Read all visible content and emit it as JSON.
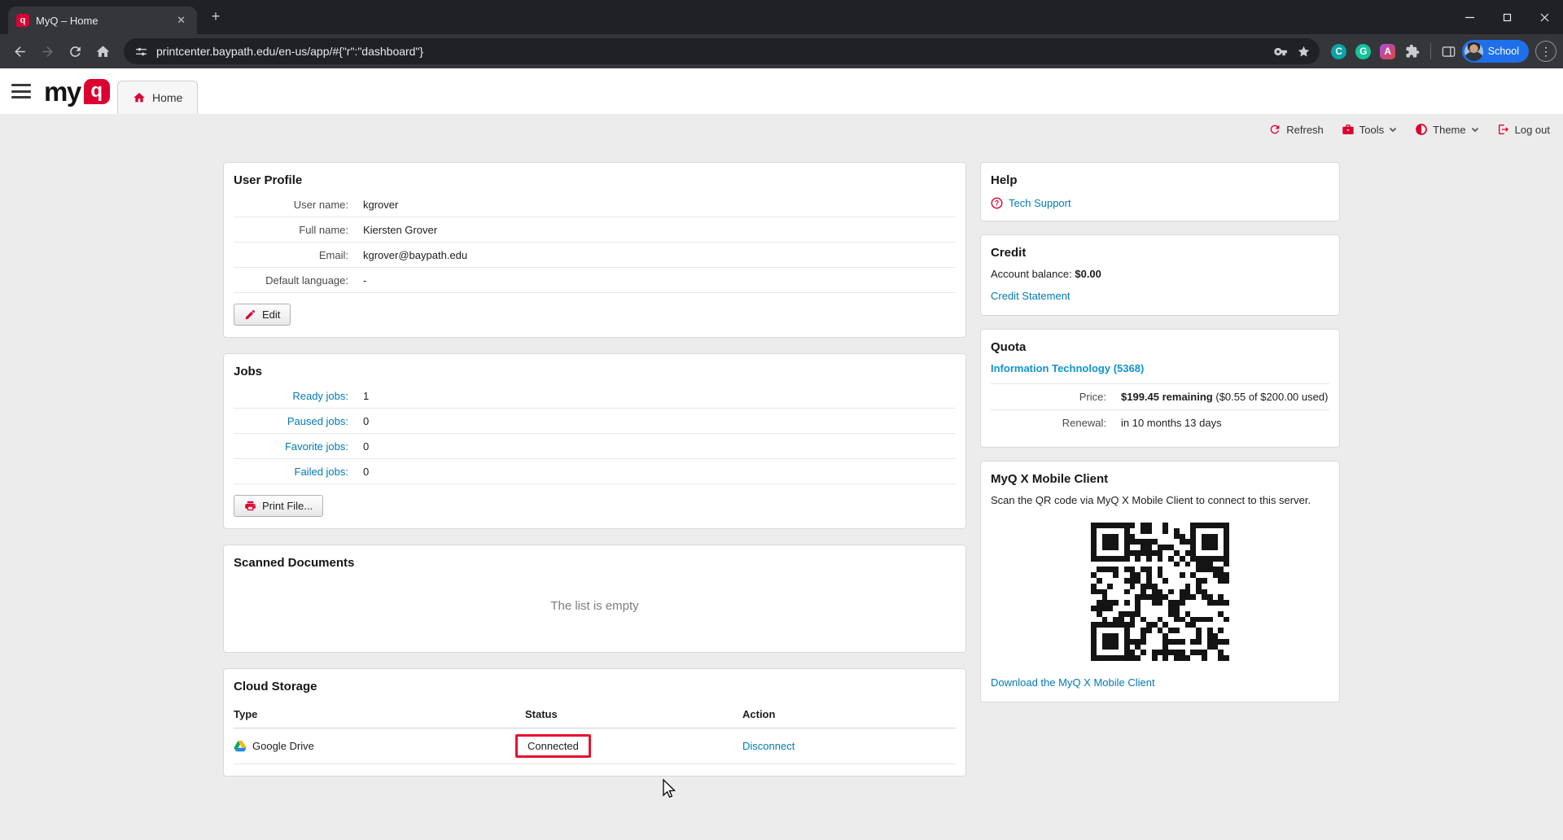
{
  "colors": {
    "brand_red": "#dc0032",
    "link_blue": "#0079b8",
    "quota_link_blue": "#0f93d0",
    "highlight_red": "#e8112d",
    "profile_chip_blue": "#1f6feb"
  },
  "browser": {
    "tab_title": "MyQ – Home",
    "url": "printcenter.baypath.edu/en-us/app/#{\"r\":\"dashboard\"}",
    "profile_label": "School"
  },
  "header": {
    "logo_prefix": "my",
    "logo_q": "q",
    "home_tab_label": "Home"
  },
  "action_bar": {
    "refresh_label": "Refresh",
    "tools_label": "Tools",
    "theme_label": "Theme",
    "logout_label": "Log out"
  },
  "cards": {
    "user_profile": {
      "title": "User Profile",
      "fields": [
        {
          "label": "User name:",
          "value": "kgrover"
        },
        {
          "label": "Full name:",
          "value": "Kiersten Grover"
        },
        {
          "label": "Email:",
          "value": "kgrover@baypath.edu"
        },
        {
          "label": "Default language:",
          "value": "-"
        }
      ],
      "edit_label": "Edit"
    },
    "jobs": {
      "title": "Jobs",
      "rows": [
        {
          "label": "Ready jobs:",
          "value": "1"
        },
        {
          "label": "Paused jobs:",
          "value": "0"
        },
        {
          "label": "Favorite jobs:",
          "value": "0"
        },
        {
          "label": "Failed jobs:",
          "value": "0"
        }
      ],
      "print_label": "Print File..."
    },
    "scanned": {
      "title": "Scanned Documents",
      "empty_text": "The list is empty"
    },
    "cloud": {
      "title": "Cloud Storage",
      "columns": {
        "type": "Type",
        "status": "Status",
        "action": "Action"
      },
      "row": {
        "type": "Google Drive",
        "status": "Connected",
        "action": "Disconnect"
      }
    },
    "help": {
      "title": "Help",
      "support_link": "Tech Support"
    },
    "credit": {
      "title": "Credit",
      "balance_label": "Account balance:",
      "balance_value": "$0.00",
      "statement_link": "Credit Statement"
    },
    "quota": {
      "title": "Quota",
      "department_link": "Information Technology (5368)",
      "price_label": "Price:",
      "price_strong": "$199.45 remaining",
      "price_rest": "($0.55 of $200.00 used)",
      "renewal_label": "Renewal:",
      "renewal_value": "in 10 months 13 days"
    },
    "mobile": {
      "title": "MyQ X Mobile Client",
      "description": "Scan the QR code via MyQ X Mobile Client to connect to this server.",
      "download_link": "Download the MyQ X Mobile Client"
    }
  }
}
